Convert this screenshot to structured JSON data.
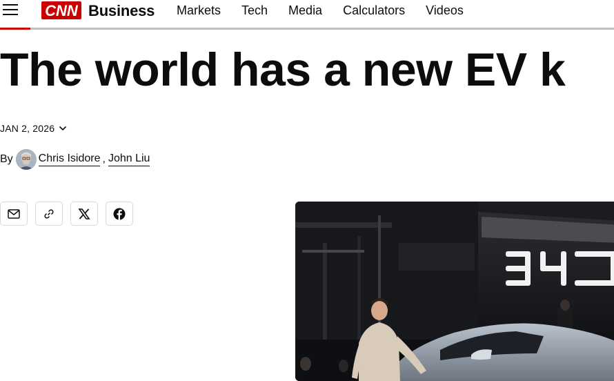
{
  "header": {
    "logo_text": "CNN",
    "section": "Business",
    "nav": [
      "Markets",
      "Tech",
      "Media",
      "Calculators",
      "Videos"
    ]
  },
  "article": {
    "headline": "The world has a new EV k",
    "date": "JAN 2, 2026",
    "byline_prefix": "By",
    "authors": [
      "Chris Isidore",
      "John Liu"
    ],
    "author_separator": ","
  },
  "share": [
    "email-icon",
    "link-icon",
    "x-icon",
    "facebook-icon"
  ],
  "hero_image": {
    "sign_text": "BYD"
  },
  "colors": {
    "brand_red": "#cc0000",
    "text": "#0c0c0c",
    "rule": "#bfbfbf"
  }
}
